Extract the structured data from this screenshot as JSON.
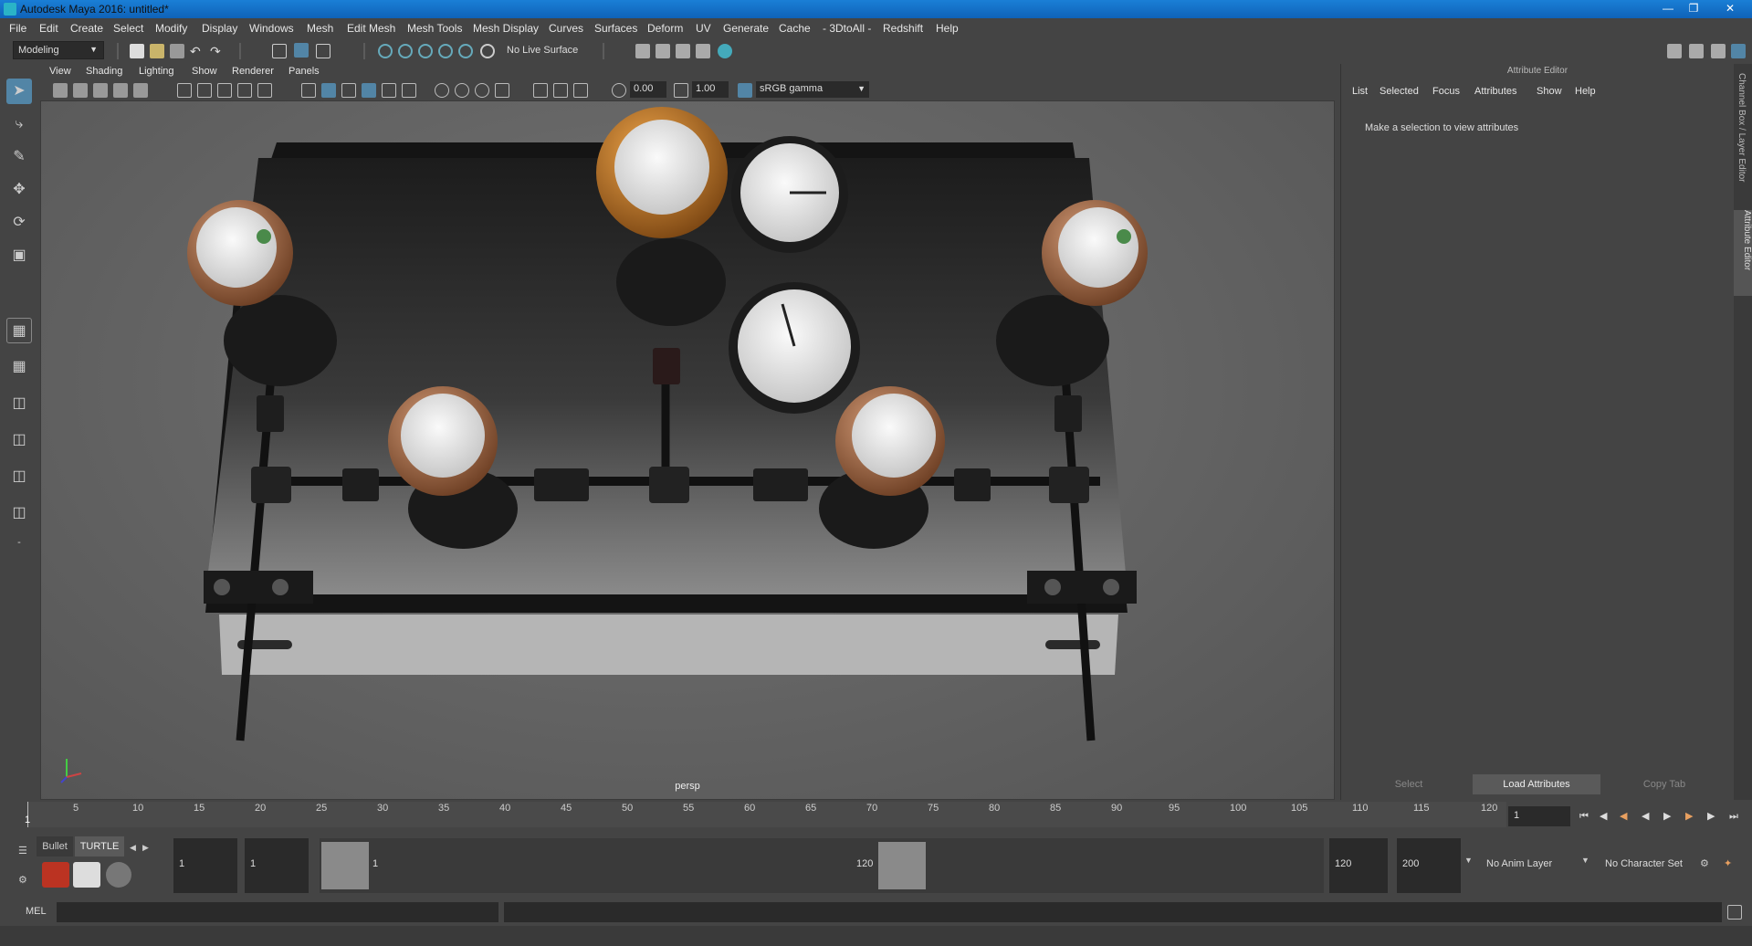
{
  "window": {
    "title": "Autodesk Maya 2016: untitled*"
  },
  "menu": [
    "File",
    "Edit",
    "Create",
    "Select",
    "Modify",
    "Display",
    "Windows",
    "Mesh",
    "Edit Mesh",
    "Mesh Tools",
    "Mesh Display",
    "Curves",
    "Surfaces",
    "Deform",
    "UV",
    "Generate",
    "Cache",
    "- 3DtoAll -",
    "Redshift",
    "Help"
  ],
  "shelf": {
    "mode": "Modeling",
    "live_surface": "No Live Surface"
  },
  "viewport": {
    "menu": [
      "View",
      "Shading",
      "Lighting",
      "Show",
      "Renderer",
      "Panels"
    ],
    "exposure": "0.00",
    "gamma": "1.00",
    "color_space": "sRGB gamma",
    "camera_label": "persp"
  },
  "attribute_editor": {
    "title": "Attribute Editor",
    "menu": [
      "List",
      "Selected",
      "Focus",
      "Attributes",
      "Show",
      "Help"
    ],
    "message": "Make a selection to view attributes",
    "buttons": {
      "select": "Select",
      "load": "Load Attributes",
      "copy": "Copy Tab"
    }
  },
  "side_tabs": {
    "channel_box": "Channel Box / Layer Editor",
    "attribute_editor": "Attribute Editor"
  },
  "timeline": {
    "ticks": [
      "5",
      "10",
      "15",
      "20",
      "25",
      "30",
      "35",
      "40",
      "45",
      "50",
      "55",
      "60",
      "65",
      "70",
      "75",
      "80",
      "85",
      "90",
      "95",
      "100",
      "105",
      "110",
      "115",
      "120"
    ],
    "current_frame_marker": "1",
    "current_frame": "1"
  },
  "range": {
    "shelf_tabs": [
      "Bullet",
      "TURTLE"
    ],
    "start": "1",
    "playback_start": "1",
    "slider_start": "1",
    "slider_end": "120",
    "playback_end": "120",
    "end": "200",
    "anim_layer": "No Anim Layer",
    "character_set": "No Character Set"
  },
  "cmd": {
    "lang": "MEL"
  },
  "colors": {
    "brand": "#0f62b8",
    "highlight_button": "#5a5a5a",
    "active_tool": "#5285a6"
  }
}
